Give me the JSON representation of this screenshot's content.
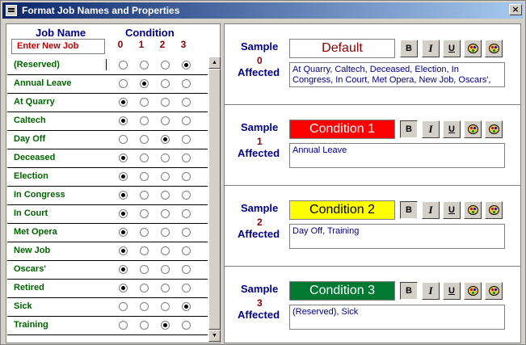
{
  "window": {
    "title": "Format Job Names and Properties",
    "close_glyph": "×"
  },
  "left": {
    "header_jobname": "Job Name",
    "header_condition": "Condition",
    "new_job_placeholder": "Enter New Job",
    "condition_numbers": [
      "0",
      "1",
      "2",
      "3"
    ],
    "jobs": [
      {
        "name": "(Reserved)",
        "condition": 3
      },
      {
        "name": "Annual Leave",
        "condition": 1
      },
      {
        "name": "At Quarry",
        "condition": 0
      },
      {
        "name": "Caltech",
        "condition": 0
      },
      {
        "name": "Day Off",
        "condition": 2
      },
      {
        "name": "Deceased",
        "condition": 0
      },
      {
        "name": "Election",
        "condition": 0
      },
      {
        "name": "In Congress",
        "condition": 0
      },
      {
        "name": "In Court",
        "condition": 0
      },
      {
        "name": "Met Opera",
        "condition": 0
      },
      {
        "name": "New Job",
        "condition": 0
      },
      {
        "name": "Oscars'",
        "condition": 0
      },
      {
        "name": "Retired",
        "condition": 0
      },
      {
        "name": "Sick",
        "condition": 3
      },
      {
        "name": "Training",
        "condition": 2
      }
    ],
    "scroll_up_glyph": "▲",
    "scroll_down_glyph": "▼"
  },
  "right": {
    "sample_label": "Sample",
    "affected_label": "Affected",
    "format_buttons": {
      "bold": "B",
      "italic": "I",
      "underline": "U"
    },
    "sections": [
      {
        "count": "0",
        "sample_text": "Default",
        "bg": "#ffffff",
        "fg": "#8b0000",
        "affected": "At Quarry, Caltech, Deceased, Election, In Congress, In Court, Met Opera, New Job, Oscars',"
      },
      {
        "count": "1",
        "sample_text": "Condition 1",
        "bg": "#ff0000",
        "fg": "#ffffff",
        "affected": "Annual Leave"
      },
      {
        "count": "2",
        "sample_text": "Condition 2",
        "bg": "#ffff00",
        "fg": "#000000",
        "affected": "Day Off, Training"
      },
      {
        "count": "3",
        "sample_text": "Condition 3",
        "bg": "#007a33",
        "fg": "#ffffff",
        "affected": "(Reserved), Sick"
      }
    ]
  }
}
